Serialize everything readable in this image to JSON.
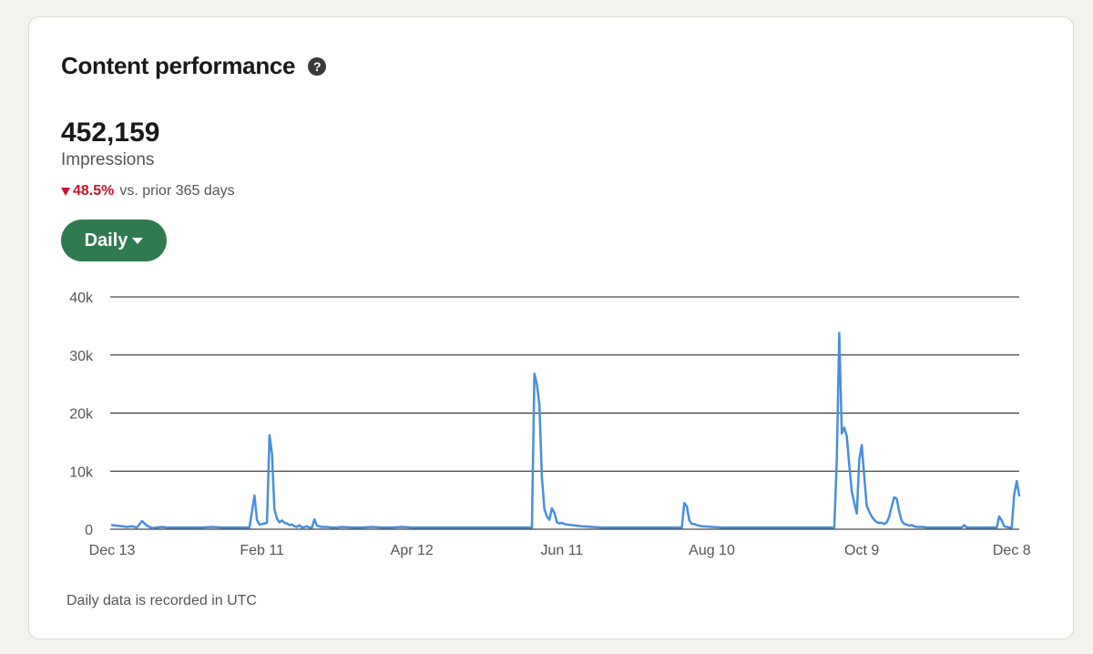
{
  "card": {
    "title": "Content performance",
    "help_icon": "question-circle-icon"
  },
  "metric": {
    "value": "452,159",
    "label": "Impressions",
    "change_pct": "48.5%",
    "change_text": "vs. prior 365 days",
    "change_direction": "down",
    "change_color": "#cb112d"
  },
  "period_button": {
    "label": "Daily",
    "color": "#2f7a4f"
  },
  "footnote": "Daily data is recorded in UTC",
  "chart_data": {
    "type": "line",
    "title": "",
    "xlabel": "",
    "ylabel": "",
    "ylim": [
      0,
      40000
    ],
    "y_ticks": [
      {
        "value": 0,
        "label": "0"
      },
      {
        "value": 10000,
        "label": "10k"
      },
      {
        "value": 20000,
        "label": "20k"
      },
      {
        "value": 30000,
        "label": "30k"
      },
      {
        "value": 40000,
        "label": "40k"
      }
    ],
    "x_ticks": [
      {
        "day": 0,
        "label": "Dec 13"
      },
      {
        "day": 60,
        "label": "Feb 11"
      },
      {
        "day": 120,
        "label": "Apr 12"
      },
      {
        "day": 180,
        "label": "Jun 11"
      },
      {
        "day": 240,
        "label": "Aug 10"
      },
      {
        "day": 300,
        "label": "Oct 9"
      },
      {
        "day": 360,
        "label": "Dec 8"
      }
    ],
    "grid": true,
    "line_color": "#4a8edb",
    "series": [
      {
        "name": "",
        "points": [
          [
            0,
            700
          ],
          [
            2,
            600
          ],
          [
            4,
            500
          ],
          [
            6,
            400
          ],
          [
            8,
            500
          ],
          [
            10,
            300
          ],
          [
            12,
            1400
          ],
          [
            14,
            600
          ],
          [
            16,
            200
          ],
          [
            18,
            300
          ],
          [
            20,
            400
          ],
          [
            22,
            300
          ],
          [
            24,
            300
          ],
          [
            28,
            300
          ],
          [
            32,
            300
          ],
          [
            36,
            300
          ],
          [
            40,
            400
          ],
          [
            44,
            300
          ],
          [
            48,
            300
          ],
          [
            52,
            300
          ],
          [
            55,
            300
          ],
          [
            57,
            5800
          ],
          [
            58,
            1600
          ],
          [
            59,
            800
          ],
          [
            60,
            900
          ],
          [
            61,
            1000
          ],
          [
            62,
            1100
          ],
          [
            63,
            16200
          ],
          [
            64,
            13000
          ],
          [
            65,
            3500
          ],
          [
            66,
            1800
          ],
          [
            67,
            1200
          ],
          [
            68,
            1500
          ],
          [
            69,
            1100
          ],
          [
            70,
            1000
          ],
          [
            71,
            700
          ],
          [
            72,
            800
          ],
          [
            73,
            500
          ],
          [
            74,
            400
          ],
          [
            75,
            700
          ],
          [
            76,
            300
          ],
          [
            77,
            400
          ],
          [
            78,
            500
          ],
          [
            79,
            300
          ],
          [
            80,
            300
          ],
          [
            81,
            1700
          ],
          [
            82,
            600
          ],
          [
            84,
            400
          ],
          [
            86,
            400
          ],
          [
            88,
            300
          ],
          [
            90,
            300
          ],
          [
            92,
            400
          ],
          [
            96,
            300
          ],
          [
            100,
            300
          ],
          [
            104,
            400
          ],
          [
            108,
            300
          ],
          [
            112,
            300
          ],
          [
            116,
            400
          ],
          [
            120,
            300
          ],
          [
            125,
            300
          ],
          [
            130,
            300
          ],
          [
            135,
            300
          ],
          [
            140,
            300
          ],
          [
            145,
            300
          ],
          [
            150,
            300
          ],
          [
            155,
            300
          ],
          [
            160,
            300
          ],
          [
            165,
            300
          ],
          [
            168,
            300
          ],
          [
            169,
            26800
          ],
          [
            170,
            25000
          ],
          [
            171,
            21500
          ],
          [
            172,
            9000
          ],
          [
            173,
            3500
          ],
          [
            174,
            2200
          ],
          [
            175,
            1600
          ],
          [
            176,
            3600
          ],
          [
            177,
            2800
          ],
          [
            178,
            1200
          ],
          [
            179,
            1000
          ],
          [
            180,
            1100
          ],
          [
            181,
            900
          ],
          [
            182,
            800
          ],
          [
            184,
            700
          ],
          [
            186,
            600
          ],
          [
            188,
            500
          ],
          [
            192,
            400
          ],
          [
            196,
            300
          ],
          [
            200,
            300
          ],
          [
            205,
            300
          ],
          [
            210,
            300
          ],
          [
            215,
            300
          ],
          [
            220,
            300
          ],
          [
            225,
            300
          ],
          [
            228,
            300
          ],
          [
            229,
            4500
          ],
          [
            230,
            3900
          ],
          [
            231,
            1500
          ],
          [
            232,
            900
          ],
          [
            233,
            900
          ],
          [
            234,
            700
          ],
          [
            236,
            500
          ],
          [
            240,
            400
          ],
          [
            244,
            300
          ],
          [
            248,
            300
          ],
          [
            252,
            300
          ],
          [
            256,
            300
          ],
          [
            260,
            300
          ],
          [
            265,
            300
          ],
          [
            270,
            300
          ],
          [
            275,
            300
          ],
          [
            280,
            300
          ],
          [
            285,
            300
          ],
          [
            289,
            300
          ],
          [
            290,
            12000
          ],
          [
            291,
            33800
          ],
          [
            292,
            16500
          ],
          [
            293,
            17500
          ],
          [
            294,
            16000
          ],
          [
            295,
            11000
          ],
          [
            296,
            6500
          ],
          [
            297,
            4500
          ],
          [
            298,
            2700
          ],
          [
            299,
            12000
          ],
          [
            300,
            14500
          ],
          [
            301,
            9000
          ],
          [
            302,
            4000
          ],
          [
            303,
            3000
          ],
          [
            304,
            2200
          ],
          [
            305,
            1600
          ],
          [
            306,
            1200
          ],
          [
            307,
            1100
          ],
          [
            308,
            1100
          ],
          [
            309,
            900
          ],
          [
            310,
            1200
          ],
          [
            311,
            2200
          ],
          [
            312,
            4000
          ],
          [
            313,
            5500
          ],
          [
            314,
            5200
          ],
          [
            315,
            3000
          ],
          [
            316,
            1400
          ],
          [
            317,
            900
          ],
          [
            318,
            800
          ],
          [
            319,
            600
          ],
          [
            320,
            700
          ],
          [
            321,
            500
          ],
          [
            322,
            400
          ],
          [
            324,
            400
          ],
          [
            326,
            300
          ],
          [
            328,
            300
          ],
          [
            330,
            300
          ],
          [
            332,
            300
          ],
          [
            334,
            300
          ],
          [
            336,
            300
          ],
          [
            338,
            300
          ],
          [
            340,
            300
          ],
          [
            341,
            700
          ],
          [
            342,
            300
          ],
          [
            344,
            300
          ],
          [
            346,
            300
          ],
          [
            348,
            300
          ],
          [
            350,
            300
          ],
          [
            352,
            300
          ],
          [
            354,
            300
          ],
          [
            355,
            2200
          ],
          [
            356,
            1500
          ],
          [
            357,
            500
          ],
          [
            358,
            400
          ],
          [
            359,
            300
          ],
          [
            360,
            300
          ],
          [
            361,
            6000
          ],
          [
            362,
            8300
          ],
          [
            363,
            5800
          ]
        ]
      }
    ]
  }
}
